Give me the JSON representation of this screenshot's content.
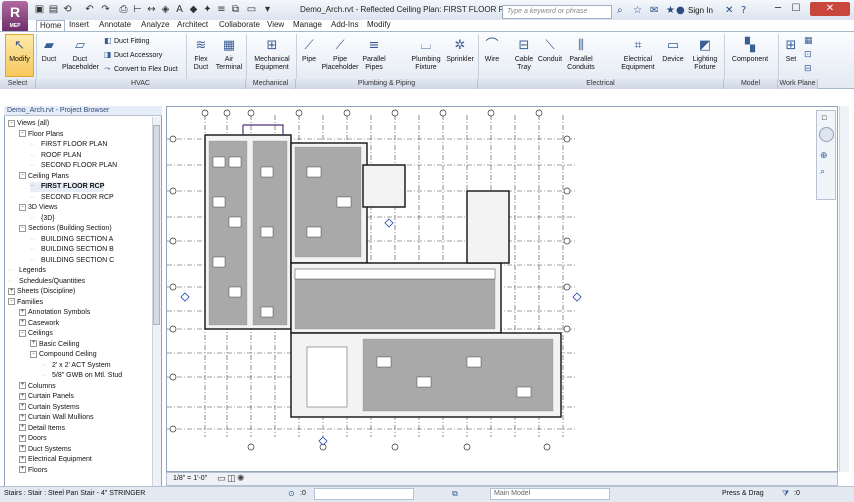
{
  "app": {
    "logo": "R",
    "logo_sub": "MEP"
  },
  "window": {
    "title": "Demo_Arch.rvt - Reflected Ceiling Plan: FIRST FLOOR RCP"
  },
  "search": {
    "placeholder": "Type a keyword or phrase"
  },
  "account": {
    "sign_in": "Sign In"
  },
  "tabs": [
    "Home",
    "Insert",
    "Annotate",
    "Analyze",
    "Architect",
    "Collaborate",
    "View",
    "Manage",
    "Add-Ins",
    "Modify"
  ],
  "ribbon": {
    "modify": "Modify",
    "duct": "Duct",
    "duct_placeholder": [
      "Duct",
      "Placeholder"
    ],
    "duct_fitting": "Duct Fitting",
    "duct_accessory": "Duct Accessory",
    "convert_flex": "Convert to Flex Duct",
    "flex_duct": [
      "Flex",
      "Duct"
    ],
    "air_terminal": [
      "Air",
      "Terminal"
    ],
    "mech_equipment": [
      "Mechanical",
      "Equipment"
    ],
    "pipe": "Pipe",
    "pipe_placeholder": [
      "Pipe",
      "Placeholder"
    ],
    "parallel_pipes": [
      "Parallel",
      "Pipes"
    ],
    "plumbing_fixture": [
      "Plumbing",
      "Fixture"
    ],
    "sprinkler": "Sprinkler",
    "wire": "Wire",
    "cable_tray": [
      "Cable",
      "Tray"
    ],
    "conduit": "Conduit",
    "parallel_conduits": [
      "Parallel",
      "Conduits"
    ],
    "electrical_equipment": [
      "Electrical",
      "Equipment"
    ],
    "device": "Device",
    "lighting_fixture": [
      "Lighting",
      "Fixture"
    ],
    "component": "Component",
    "set": "Set",
    "panels": [
      "Select",
      "HVAC",
      "Mechanical",
      "Plumbing & Piping",
      "Electrical",
      "Model",
      "Work Plane"
    ]
  },
  "browser": {
    "title": "Demo_Arch.rvt - Project Browser",
    "items": [
      {
        "label": "Views (all)",
        "level": 0,
        "exp": "-"
      },
      {
        "label": "Floor Plans",
        "level": 1,
        "exp": "-"
      },
      {
        "label": "FIRST FLOOR PLAN",
        "level": 2,
        "exp": ""
      },
      {
        "label": "ROOF PLAN",
        "level": 2,
        "exp": ""
      },
      {
        "label": "SECOND FLOOR PLAN",
        "level": 2,
        "exp": ""
      },
      {
        "label": "Ceiling Plans",
        "level": 1,
        "exp": "-"
      },
      {
        "label": "FIRST FLOOR RCP",
        "level": 2,
        "exp": "",
        "selected": true
      },
      {
        "label": "SECOND FLOOR RCP",
        "level": 2,
        "exp": ""
      },
      {
        "label": "3D Views",
        "level": 1,
        "exp": "-"
      },
      {
        "label": "{3D}",
        "level": 2,
        "exp": ""
      },
      {
        "label": "Sections (Building Section)",
        "level": 1,
        "exp": "-"
      },
      {
        "label": "BUILDING SECTION A",
        "level": 2,
        "exp": ""
      },
      {
        "label": "BUILDING SECTION B",
        "level": 2,
        "exp": ""
      },
      {
        "label": "BUILDING SECTION C",
        "level": 2,
        "exp": ""
      },
      {
        "label": "Legends",
        "level": 0,
        "exp": ""
      },
      {
        "label": "Schedules/Quantities",
        "level": 0,
        "exp": ""
      },
      {
        "label": "Sheets (Discipline)",
        "level": 0,
        "exp": "+"
      },
      {
        "label": "Families",
        "level": 0,
        "exp": "-"
      },
      {
        "label": "Annotation Symbols",
        "level": 1,
        "exp": "+"
      },
      {
        "label": "Casework",
        "level": 1,
        "exp": "+"
      },
      {
        "label": "Ceilings",
        "level": 1,
        "exp": "-"
      },
      {
        "label": "Basic Ceiling",
        "level": 2,
        "exp": "+"
      },
      {
        "label": "Compound Ceiling",
        "level": 2,
        "exp": "-"
      },
      {
        "label": "2' x 2' ACT System",
        "level": 3,
        "exp": ""
      },
      {
        "label": "5/8\" GWB on Mtl. Stud",
        "level": 3,
        "exp": ""
      },
      {
        "label": "Columns",
        "level": 1,
        "exp": "+"
      },
      {
        "label": "Curtain Panels",
        "level": 1,
        "exp": "+"
      },
      {
        "label": "Curtain Systems",
        "level": 1,
        "exp": "+"
      },
      {
        "label": "Curtain Wall Mullions",
        "level": 1,
        "exp": "+"
      },
      {
        "label": "Detail Items",
        "level": 1,
        "exp": "+"
      },
      {
        "label": "Doors",
        "level": 1,
        "exp": "+"
      },
      {
        "label": "Duct Systems",
        "level": 1,
        "exp": "+"
      },
      {
        "label": "Electrical Equipment",
        "level": 1,
        "exp": "+"
      },
      {
        "label": "Floors",
        "level": 1,
        "exp": "+"
      }
    ]
  },
  "view_control": {
    "scale": "1/8\" = 1'-0\""
  },
  "status": {
    "text": "Stairs : Stair : Steel Pan Stair - 4\" STRINGER",
    "workset": ":0",
    "model": "Main Model",
    "press_drag": "Press & Drag",
    "filter": ":0"
  }
}
